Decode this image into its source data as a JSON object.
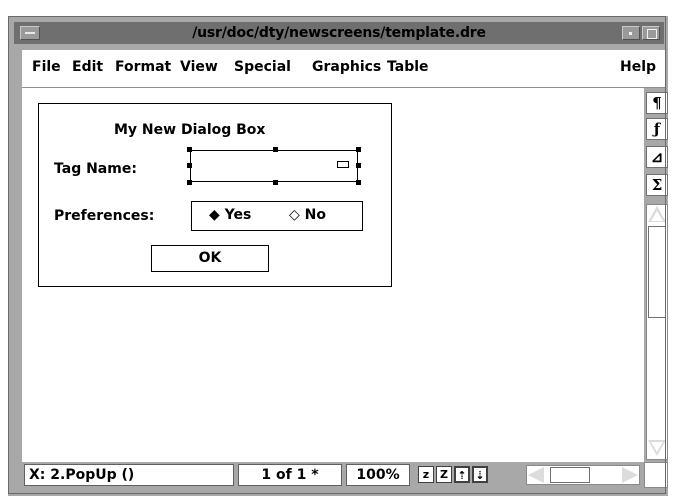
{
  "window": {
    "title": "/usr/doc/dty/newscreens/template.dre"
  },
  "menu": {
    "file": "File",
    "edit": "Edit",
    "format": "Format",
    "view": "View",
    "special": "Special",
    "graphics": "Graphics",
    "table": "Table",
    "help": "Help"
  },
  "dialog": {
    "title": "My New Dialog Box",
    "tag_label": "Tag Name:",
    "pref_label": "Preferences:",
    "yes_label": "◆ Yes",
    "no_label": "◇ No",
    "ok_label": "OK"
  },
  "tools": {
    "paragraph": "¶",
    "function": "ƒ",
    "triangle": "⊿",
    "sigma": "Σ"
  },
  "status": {
    "element": "X:  2.PopUp ()",
    "page": "1 of 1 *",
    "zoom": "100%",
    "z_small": "z",
    "z_large": "Z",
    "insert_before": "⇡",
    "insert_after": "⇣"
  },
  "icons": [
    "window-menu-icon",
    "minimize-icon",
    "maximize-icon",
    "paragraph-icon",
    "function-icon",
    "triangle-icon",
    "sigma-icon"
  ]
}
